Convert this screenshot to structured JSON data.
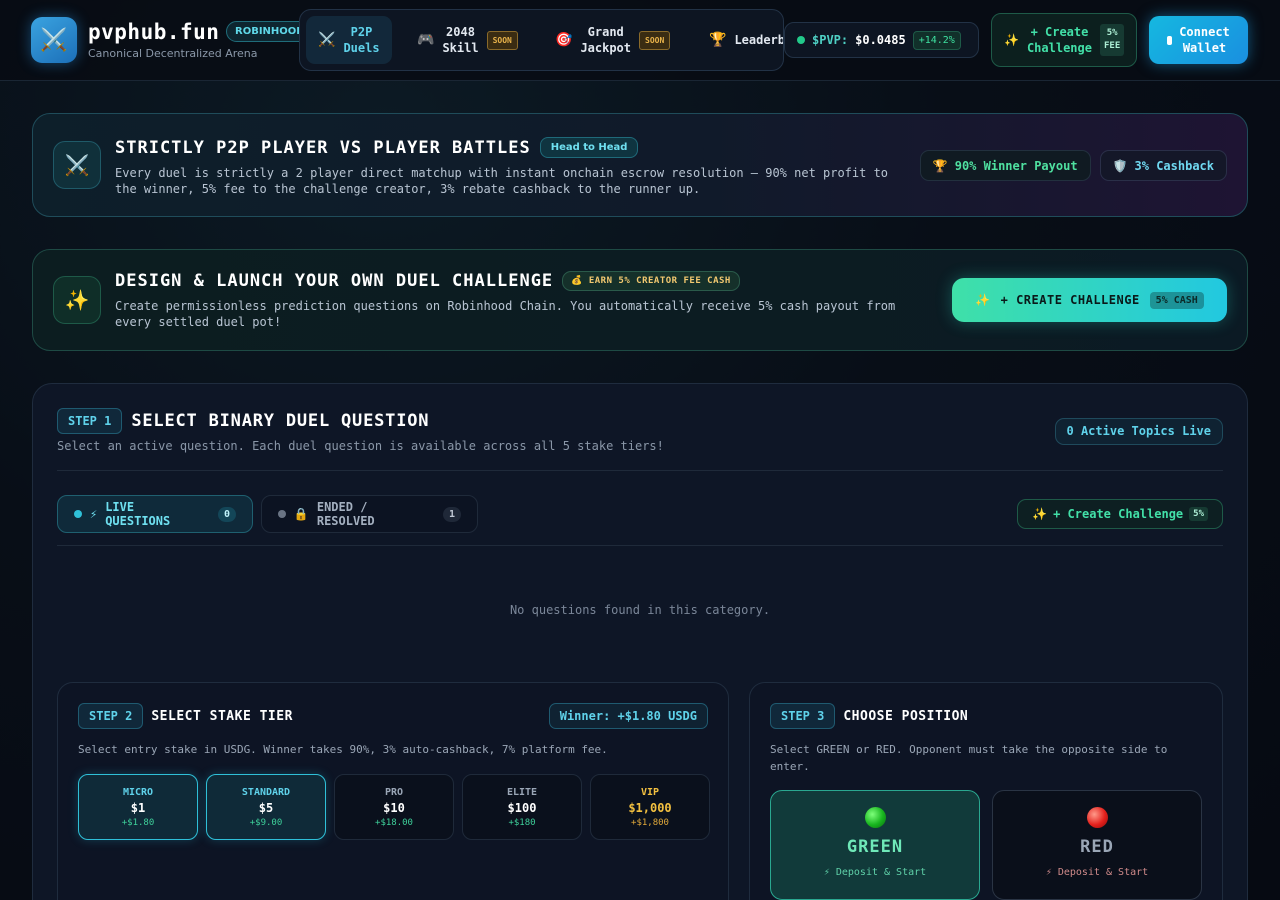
{
  "header": {
    "logo_icon": "crossed-swords-icon",
    "brand_name": "pvphub.fun",
    "brand_badge": "ROBINHOOD",
    "brand_sub": "Canonical Decentralized Arena",
    "nav": [
      {
        "icon": "⚔️",
        "line1": "P2P",
        "line2": "Duels",
        "active": true
      },
      {
        "icon": "🎮",
        "line1": "2048",
        "line2": "Skill",
        "badge": "SOON"
      },
      {
        "icon": "🎯",
        "line1": "Grand",
        "line2": "Jackpot",
        "badge": "SOON"
      },
      {
        "icon": "🏆",
        "line1": "Leaderb",
        "line2": ""
      }
    ],
    "price_label": "$PVP:",
    "price_value": "$0.0485",
    "price_change": "+14.2%",
    "create": {
      "icon": "✨",
      "line1": "+ Create",
      "line2": "Challenge",
      "fee1": "5%",
      "fee2": "FEE"
    },
    "connect": {
      "line1": "Connect",
      "line2": "Wallet"
    }
  },
  "banner1": {
    "icon": "⚔️",
    "title": "STRICTLY P2P PLAYER VS PLAYER BATTLES",
    "tag": "Head to Head",
    "desc": "Every duel is strictly a 2 player direct matchup with instant onchain escrow resolution — 90% net profit to the winner, 5% fee to the challenge creator, 3% rebate cashback to the runner up.",
    "pill_win_icon": "🏆",
    "pill_win": "90% Winner Payout",
    "pill_cash_icon": "🛡️",
    "pill_cash": "3% Cashback"
  },
  "banner2": {
    "icon": "✨",
    "title": "DESIGN & LAUNCH YOUR OWN DUEL CHALLENGE",
    "tag_icon": "💰",
    "tag": "EARN 5% CREATOR FEE CASH",
    "desc": "Create permissionless prediction questions on Robinhood Chain. You automatically receive 5% cash payout from every settled duel pot!",
    "button_icon": "✨",
    "button": "+ CREATE CHALLENGE",
    "button_tag": "5% CASH"
  },
  "step1": {
    "badge": "STEP 1",
    "title": "SELECT BINARY DUEL QUESTION",
    "desc": "Select an active question. Each duel question is available across all 5 stake tiers!",
    "active_topics": "0 Active Topics Live",
    "tab_live_icon": "⚡",
    "tab_live": "LIVE QUESTIONS",
    "tab_live_count": "0",
    "tab_ended_icon": "🔒",
    "tab_ended": "ENDED / RESOLVED",
    "tab_ended_count": "1",
    "create_icon": "✨",
    "create_label": "+ Create Challenge",
    "create_fee": "5%",
    "empty": "No questions found in this category."
  },
  "step2": {
    "badge": "STEP 2",
    "title": "SELECT STAKE TIER",
    "winner": "Winner: +$1.80 USDG",
    "desc": "Select entry stake in USDG. Winner takes 90%, 3% auto-cashback, 7% platform fee.",
    "tiers": [
      {
        "name": "MICRO",
        "value": "$1",
        "gain": "+$1.80",
        "selected": true
      },
      {
        "name": "STANDARD",
        "value": "$5",
        "gain": "+$9.00",
        "selected": true
      },
      {
        "name": "PRO",
        "value": "$10",
        "gain": "+$18.00"
      },
      {
        "name": "ELITE",
        "value": "$100",
        "gain": "+$180"
      },
      {
        "name": "VIP",
        "value": "$1,000",
        "gain": "+$1,800",
        "vip": true
      }
    ]
  },
  "step3": {
    "badge": "STEP 3",
    "title": "CHOOSE POSITION",
    "desc": "Select GREEN or RED. Opponent must take the opposite side to enter.",
    "green": {
      "name": "GREEN",
      "action": "⚡ Deposit & Start"
    },
    "red": {
      "name": "RED",
      "action": "⚡ Deposit & Start"
    }
  }
}
